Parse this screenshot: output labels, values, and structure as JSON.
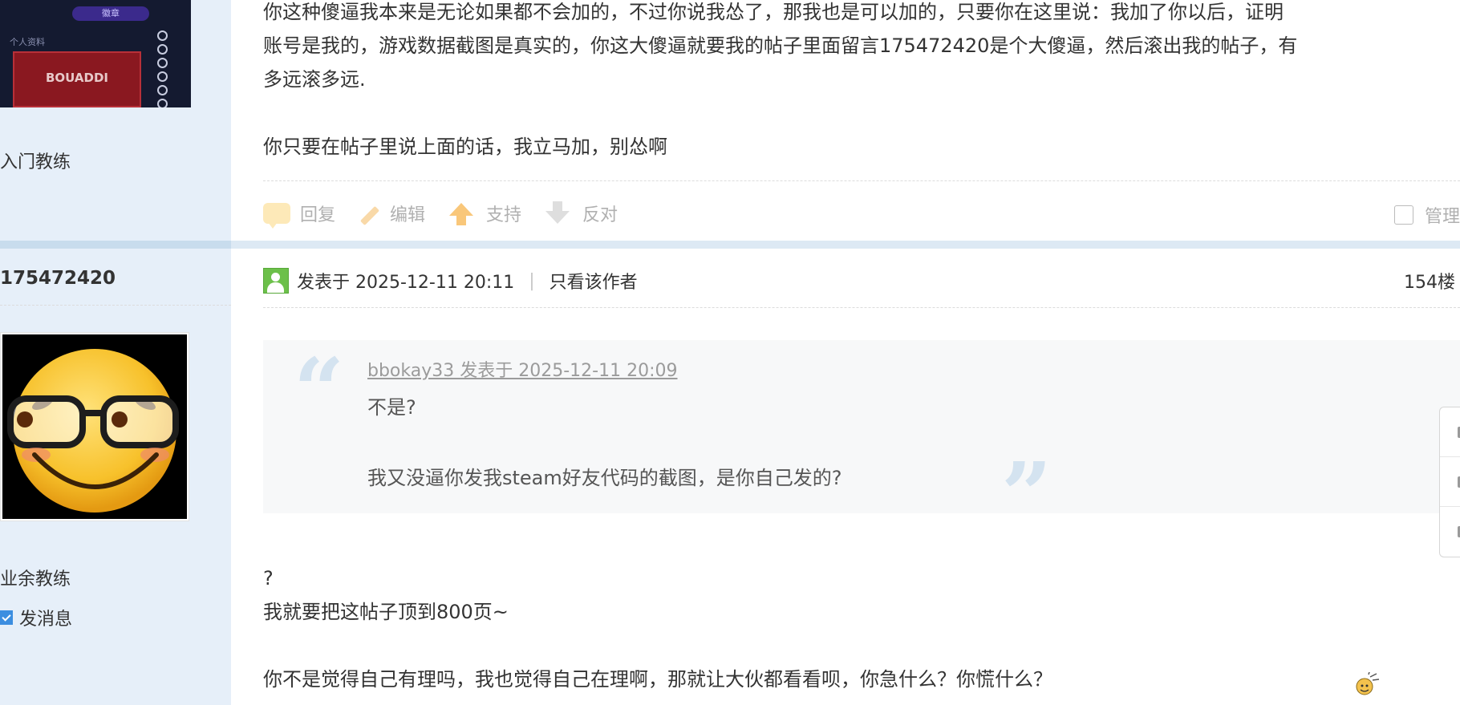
{
  "previous_post": {
    "avatar_badge": "徽章",
    "avatar_label": "个人资料",
    "avatar_card_name": "BOUADDI",
    "rank": "入门教练",
    "paragraphs": [
      "你这种傻逼我本来是无论如果都不会加的，不过你说我怂了，那我也是可以加的，只要你在这里说：我加了你以后，证明",
      "账号是我的，游戏数据截图是真实的，你这大傻逼就要我的帖子里面留言175472420是个大傻逼，然后滚出我的帖子，有",
      "多远滚多远.",
      "你只要在帖子里说上面的话，我立马加，别怂啊"
    ],
    "actions": {
      "reply": "回复",
      "edit": "编辑",
      "support": "支持",
      "oppose": "反对",
      "manage": "管理"
    }
  },
  "post": {
    "author": "175472420",
    "rank": "业余教练",
    "send_message": "发消息",
    "posted_at": "发表于 2025-12-11 20:11",
    "only_author": "只看该作者",
    "floor": "154楼",
    "quote": {
      "header": "bbokay33 发表于 2025-12-11 20:09",
      "line1": "不是?",
      "line2": "我又没逼你发我steam好友代码的截图，是你自己发的?"
    },
    "body": [
      "?",
      "我就要把这帖子顶到800页~",
      "你不是觉得自己有理吗，我也觉得自己在理啊，那就让大伙都看看呗，你急什么？你慌什么？"
    ]
  },
  "icons": {
    "reply": "speech-bubble-icon",
    "edit": "pencil-icon",
    "support": "thumb-up-arrow-icon",
    "oppose": "thumb-down-arrow-icon",
    "user": "user-icon",
    "message": "message-icon"
  },
  "colors": {
    "sidebar_bg": "#e6eff9",
    "separator": "#dde9f4",
    "quote_bg": "#f7f8f9",
    "quote_mark": "#d4e3f0",
    "user_icon": "#6cc04a",
    "message_icon": "#3c8ee0"
  }
}
